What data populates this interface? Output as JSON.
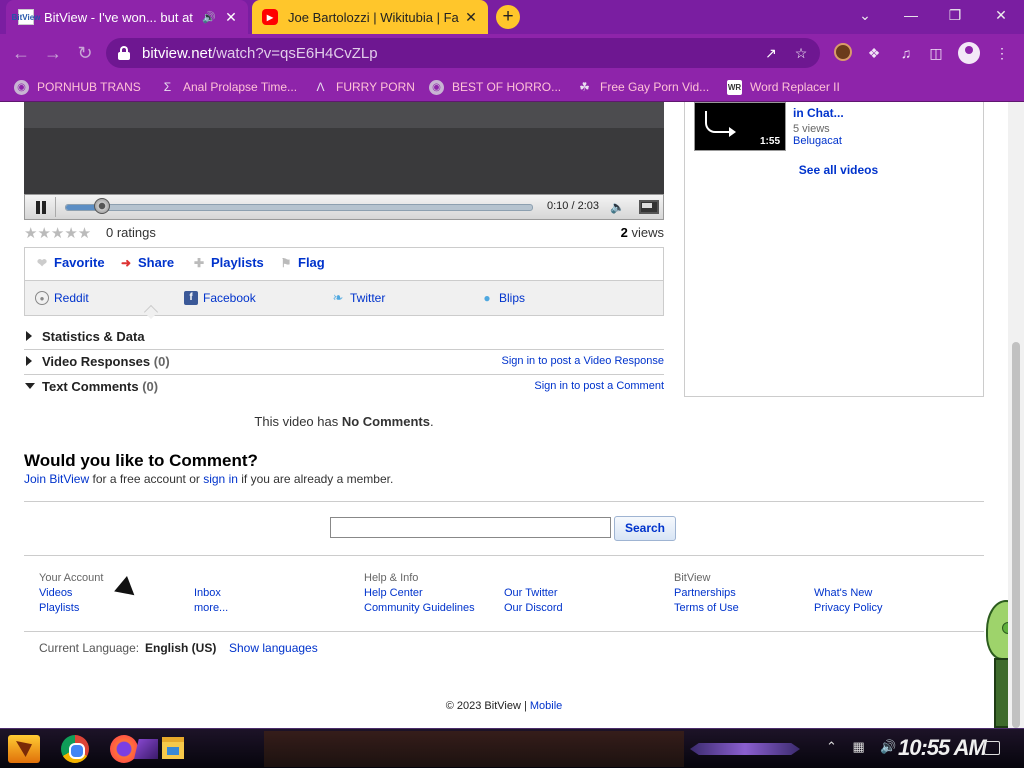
{
  "browser": {
    "tabs": [
      {
        "title": "BitView - I've won... but at",
        "favicon": "BitView",
        "active": true
      },
      {
        "title": "Joe Bartolozzi | Wikitubia | Fa",
        "favicon": "youtube",
        "active": false
      }
    ],
    "url_host": "bitview.net",
    "url_path": "/watch?v=qsE6H4CvZLp",
    "accent": "#8e24aa",
    "bookmarks": [
      {
        "label": "PORNHUB TRANS",
        "icon": "globe"
      },
      {
        "label": "Anal Prolapse Time...",
        "icon": "sigma"
      },
      {
        "label": "FURRY PORN",
        "icon": "lambda"
      },
      {
        "label": "BEST OF HORRO...",
        "icon": "globe"
      },
      {
        "label": "Free Gay Porn Vid...",
        "icon": "wolf"
      },
      {
        "label": "Word Replacer II",
        "icon": "WR"
      }
    ]
  },
  "player": {
    "time": "0:10 / 2:03",
    "progress": 0.08
  },
  "video_meta": {
    "ratings": "0 ratings",
    "views_count": "2",
    "views_label": "views"
  },
  "actions": {
    "favorite": "Favorite",
    "share": "Share",
    "playlists": "Playlists",
    "flag": "Flag"
  },
  "share_sites": [
    "Reddit",
    "Facebook",
    "Twitter",
    "Blips"
  ],
  "sections": {
    "statistics": "Statistics & Data",
    "responses": "Video Responses",
    "responses_count": "(0)",
    "responses_link": "Sign in to post a Video Response",
    "comments": "Text Comments",
    "comments_count": "(0)",
    "comments_link": "Sign in to post a Comment"
  },
  "comments": {
    "empty_prefix": "This video has ",
    "empty_bold": "No Comments",
    "empty_suffix": ".",
    "heading": "Would you like to Comment?",
    "join": "Join BitView",
    "mid": " for a free account or ",
    "signin": "sign in",
    "tail": " if you are already a member."
  },
  "search": {
    "value": "",
    "button": "Search"
  },
  "footer": {
    "your_account": "Your Account",
    "videos": "Videos",
    "playlists": "Playlists",
    "inbox": "Inbox",
    "more": "more...",
    "help_info": "Help & Info",
    "help_center": "Help Center",
    "community_guidelines": "Community Guidelines",
    "our_twitter": "Our Twitter",
    "our_discord": "Our Discord",
    "bitview": "BitView",
    "partnerships": "Partnerships",
    "terms": "Terms of Use",
    "whats_new": "What's New",
    "privacy": "Privacy Policy",
    "language_label": "Current Language:",
    "language_value": "English (US)",
    "show_languages": "Show languages",
    "copyright": "© 2023 BitView",
    "mobile": "Mobile"
  },
  "related": {
    "title": "in Chat...",
    "views": "5 views",
    "author": "Belugacat",
    "duration": "1:55",
    "see_all": "See all videos"
  },
  "taskbar": {
    "clock": "10:55 AM"
  }
}
